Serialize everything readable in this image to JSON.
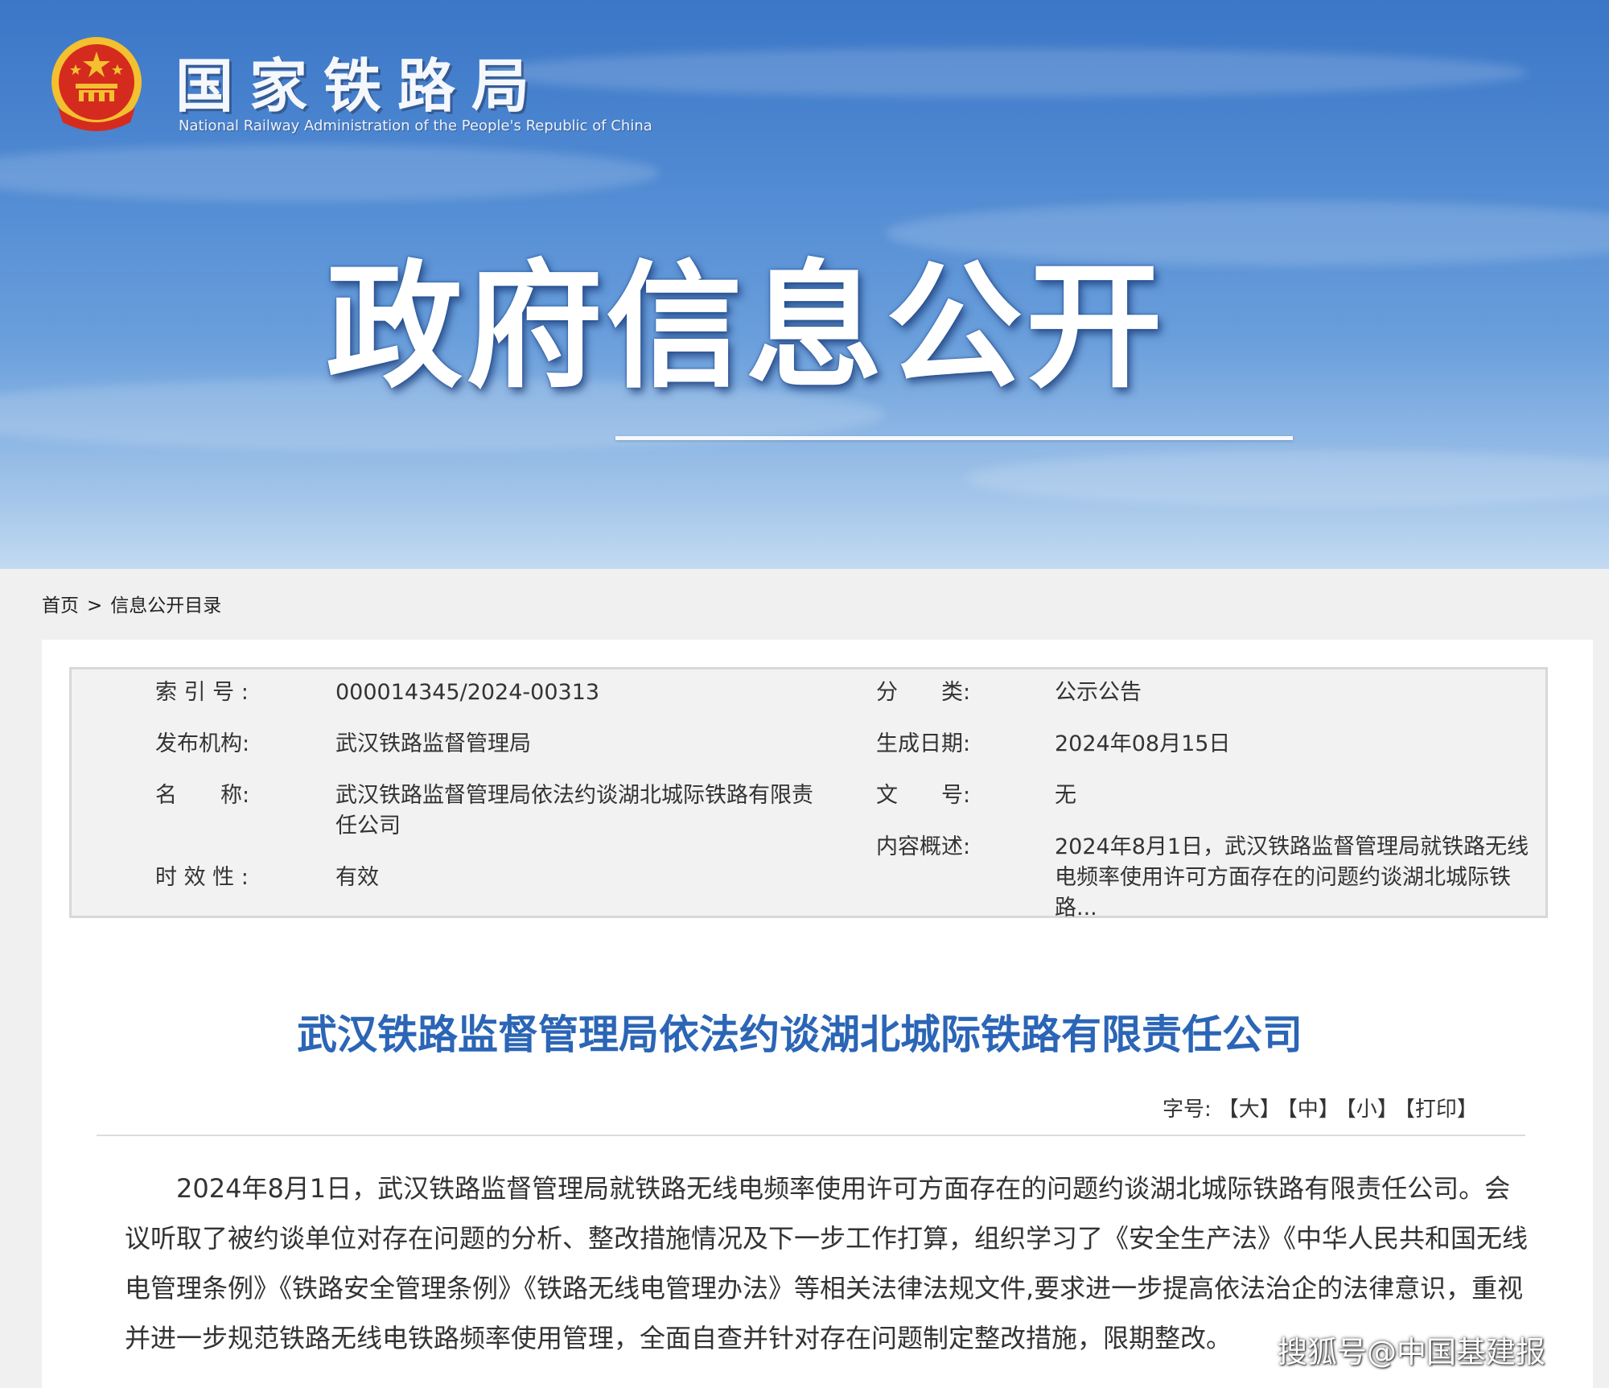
{
  "colors": {
    "banner_top": "#3b76c7",
    "banner_bottom": "#c3daf1",
    "title_blue": "#2b65b6",
    "emblem_red": "#d52b1e",
    "emblem_gold": "#f3c02f"
  },
  "header": {
    "org_name_cn": "国家铁路局",
    "org_name_en": "National Railway Administration of the People's Republic of China",
    "emblem_icon": "national-emblem-icon",
    "banner_title": "政府信息公开"
  },
  "breadcrumb": {
    "home": "首页",
    "separator": ">",
    "current": "信息公开目录"
  },
  "meta": {
    "index_no_label": "索 引 号 :",
    "index_no": "000014345/2024-00313",
    "category_label": "分　　类:",
    "category": "公示公告",
    "publisher_label": "发布机构:",
    "publisher": "武汉铁路监督管理局",
    "date_label": "生成日期:",
    "date": "2024年08月15日",
    "name_label": "名　　称:",
    "name": "武汉铁路监督管理局依法约谈湖北城际铁路有限责任公司",
    "doc_no_label": "文　　号:",
    "doc_no": "无",
    "summary_label": "内容概述:",
    "summary": "2024年8月1日，武汉铁路监督管理局就铁路无线电频率使用许可方面存在的问题约谈湖北城际铁路...",
    "validity_label": "时 效 性 :",
    "validity": "有效"
  },
  "article": {
    "title": "武汉铁路监督管理局依法约谈湖北城际铁路有限责任公司",
    "font_size_label": "字号:",
    "font_large": "【大】",
    "font_medium": "【中】",
    "font_small": "【小】",
    "print": "【打印】",
    "body": "2024年8月1日，武汉铁路监督管理局就铁路无线电频率使用许可方面存在的问题约谈湖北城际铁路有限责任公司。会议听取了被约谈单位对存在问题的分析、整改措施情况及下一步工作打算，组织学习了《安全生产法》《中华人民共和国无线电管理条例》《铁路安全管理条例》《铁路无线电管理办法》等相关法律法规文件,要求进一步提高依法治企的法律意识，重视并进一步规范铁路无线电铁路频率使用管理，全面自查并针对存在问题制定整改措施，限期整改。"
  },
  "watermark": "搜狐号@中国基建报"
}
